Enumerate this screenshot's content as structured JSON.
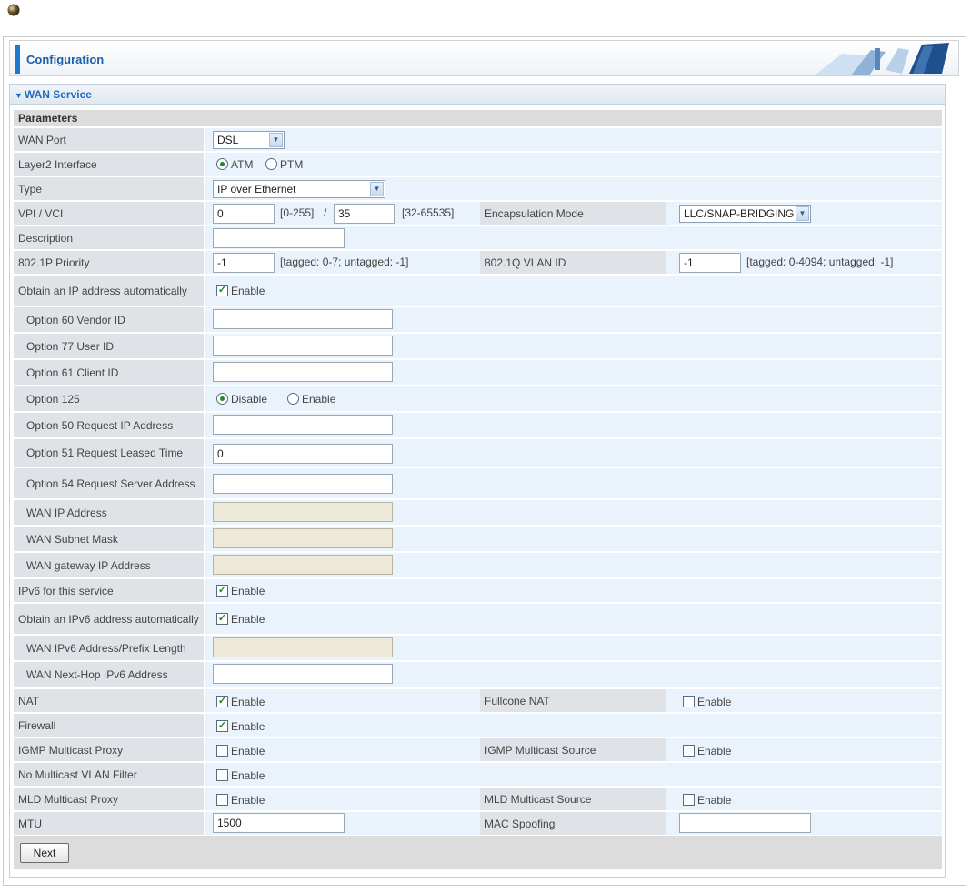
{
  "header": {
    "title": "Configuration"
  },
  "section": {
    "title": "WAN Service",
    "params_title": "Parameters"
  },
  "fields": {
    "wan_port": {
      "label": "WAN Port",
      "value": "DSL"
    },
    "layer2": {
      "label": "Layer2 Interface",
      "opt1": "ATM",
      "opt2": "PTM"
    },
    "type": {
      "label": "Type",
      "value": "IP over Ethernet"
    },
    "vpi_vci": {
      "label": "VPI / VCI",
      "vpi": "0",
      "vpi_range": "[0-255]",
      "sep": "/",
      "vci": "35",
      "vci_range": "[32-65535]"
    },
    "encap": {
      "label": "Encapsulation Mode",
      "value": "LLC/SNAP-BRIDGING"
    },
    "description": {
      "label": "Description",
      "value": ""
    },
    "priority": {
      "label": "802.1P Priority",
      "value": "-1",
      "hint": "[tagged: 0-7; untagged: -1]"
    },
    "vlan": {
      "label": "802.1Q VLAN ID",
      "value": "-1",
      "hint": "[tagged: 0-4094; untagged: -1]"
    },
    "obtain_ip": {
      "label": "Obtain an IP address automatically",
      "check": "Enable"
    },
    "opt60": {
      "label": "Option 60 Vendor ID",
      "value": ""
    },
    "opt77": {
      "label": "Option 77 User ID",
      "value": ""
    },
    "opt61": {
      "label": "Option 61 Client ID",
      "value": ""
    },
    "opt125": {
      "label": "Option 125",
      "opt1": "Disable",
      "opt2": "Enable"
    },
    "opt50": {
      "label": "Option 50 Request IP Address",
      "value": ""
    },
    "opt51": {
      "label": "Option 51 Request Leased Time",
      "value": "0"
    },
    "opt54": {
      "label": "Option 54 Request Server Address",
      "value": ""
    },
    "wan_ip": {
      "label": "WAN IP Address",
      "value": ""
    },
    "wan_mask": {
      "label": "WAN Subnet Mask",
      "value": ""
    },
    "wan_gw": {
      "label": "WAN gateway IP Address",
      "value": ""
    },
    "ipv6": {
      "label": "IPv6 for this service",
      "check": "Enable"
    },
    "obtain_ipv6": {
      "label": "Obtain an IPv6 address automatically",
      "check": "Enable"
    },
    "ipv6_addr": {
      "label": "WAN IPv6 Address/Prefix Length",
      "value": ""
    },
    "ipv6_nexthop": {
      "label": "WAN Next-Hop IPv6 Address",
      "value": ""
    },
    "nat": {
      "label": "NAT",
      "check": "Enable"
    },
    "fullcone": {
      "label": "Fullcone NAT",
      "check": "Enable"
    },
    "firewall": {
      "label": "Firewall",
      "check": "Enable"
    },
    "igmp_proxy": {
      "label": "IGMP Multicast Proxy",
      "check": "Enable"
    },
    "igmp_source": {
      "label": "IGMP Multicast Source",
      "check": "Enable"
    },
    "no_vlan_filter": {
      "label": "No Multicast VLAN Filter",
      "check": "Enable"
    },
    "mld_proxy": {
      "label": "MLD Multicast Proxy",
      "check": "Enable"
    },
    "mld_source": {
      "label": "MLD Multicast Source",
      "check": "Enable"
    },
    "mtu": {
      "label": "MTU",
      "value": "1500"
    },
    "mac_spoof": {
      "label": "MAC Spoofing",
      "value": ""
    }
  },
  "buttons": {
    "next": "Next"
  },
  "colors": {
    "accent": "#1a7bd1",
    "label_bg": "#dfe3e8",
    "value_bg": "#eaf3fb",
    "check": "#1b8a2a"
  }
}
